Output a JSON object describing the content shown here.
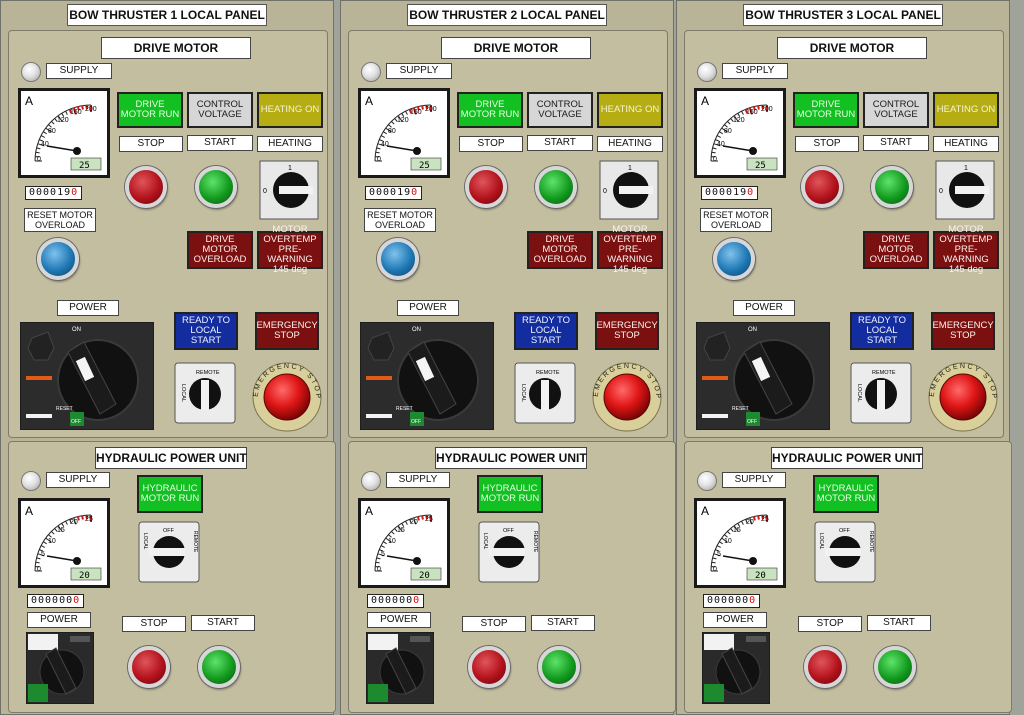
{
  "thrusters": [
    {
      "title": "BOW THRUSTER 1 LOCAL PANEL"
    },
    {
      "title": "BOW THRUSTER 2 LOCAL PANEL"
    },
    {
      "title": "BOW THRUSTER 3 LOCAL PANEL"
    }
  ],
  "drive": {
    "title": "DRIVE MOTOR",
    "supply": "SUPPLY",
    "ammeter": {
      "unit": "A",
      "ticks": [
        "0",
        "40",
        "80",
        "120",
        "160",
        "200"
      ],
      "reading": "25"
    },
    "counter": {
      "digits": "000019",
      "last": "0"
    },
    "ind_run": "DRIVE MOTOR RUN",
    "ind_control": "CONTROL VOLTAGE",
    "ind_heating": "HEATING ON",
    "stop": "STOP",
    "start": "START",
    "heating": "HEATING",
    "heating_switch": {
      "off": "0",
      "on": "1"
    },
    "reset": "RESET MOTOR OVERLOAD",
    "ind_overload": "DRIVE MOTOR OVERLOAD",
    "ind_overtemp": "MOTOR OVERTEMP PRE-WARNING 145 deg",
    "power": "POWER",
    "breaker": {
      "on": "ON",
      "off": "OFF",
      "reset": "RESET"
    },
    "ind_ready": "READY TO LOCAL START",
    "ind_emergency": "EMERGENCY STOP",
    "mode_switch": {
      "remote": "REMOTE",
      "local": "LOCAL"
    },
    "estop_ring": "EMERGENCY STOP"
  },
  "hpu": {
    "title": "HYDRAULIC POWER UNIT",
    "supply": "SUPPLY",
    "ammeter": {
      "unit": "A",
      "ticks": [
        "0",
        "5",
        "10",
        "15",
        "20",
        "25"
      ],
      "reading": "20"
    },
    "ind_run": "HYDRAULIC MOTOR RUN",
    "mode_switch": {
      "off": "OFF",
      "local": "LOCAL",
      "remote": "REMOTE"
    },
    "counter": {
      "digits": "000000",
      "last": "0"
    },
    "power": "POWER",
    "stop": "STOP",
    "start": "START"
  },
  "colors": {
    "panel": "#c4bea1",
    "green_lamp": "#12c021",
    "red_lamp": "#7a1010",
    "blue_lamp": "#132c9e",
    "olive_lamp": "#b6ad14"
  }
}
